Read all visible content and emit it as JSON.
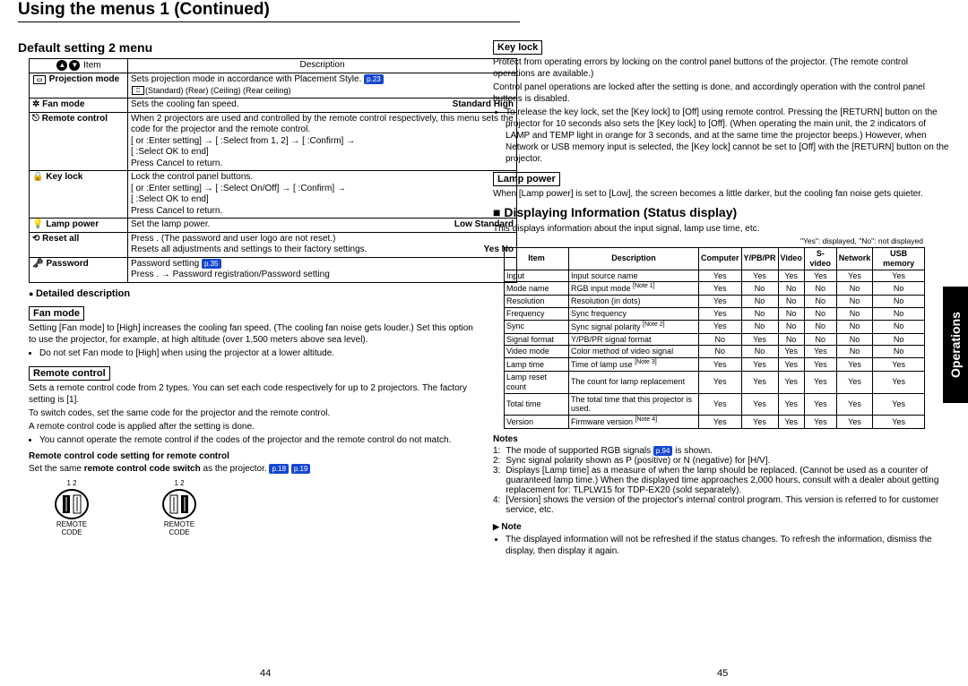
{
  "page_title": "Using the menus 1 (Continued)",
  "left": {
    "menu_title": "Default setting 2 menu",
    "table_header_item": "Item",
    "table_header_desc": "Description",
    "rows": {
      "proj_item": "Projection mode",
      "proj_desc_l1": "Sets projection mode in accordance with Placement Style.",
      "proj_desc_l2": "(Standard)          (Rear)          (Ceiling)          (Rear ceiling)",
      "fan_item": "Fan mode",
      "fan_desc": "Sets the cooling fan speed.",
      "fan_opts": "Standard      High",
      "rc_item": "Remote control",
      "rc_desc_l1": "When 2 projectors are used and controlled by the remote control respectively, this menu sets the code for the projector and the remote control.",
      "rc_desc_l2": "[   or   :Enter setting] → [     :Select from 1, 2] → [   :Confirm] →",
      "rc_desc_l3": "[     :Select OK to end]",
      "rc_desc_l4": "Press Cancel to return.",
      "key_item": "Key lock",
      "key_desc_l1": "Lock the control panel buttons.",
      "key_desc_l2": "[   or   :Enter setting] → [     :Select On/Off] → [   :Confirm] →",
      "key_desc_l3": "[     :Select OK to end]",
      "key_desc_l4": "Press Cancel to return.",
      "lamp_item": "Lamp power",
      "lamp_desc": "Set the lamp power.",
      "lamp_opts": "Low      Standard",
      "reset_item": "Reset all",
      "reset_desc_l1": "Press    . (The password and user logo are not reset.)",
      "reset_desc_l2": "Resets all adjustments and settings to their factory settings.",
      "reset_opts": "Yes      No",
      "pw_item": "Password",
      "pw_desc_l1": "Password setting",
      "pw_desc_l2": "Press    . → Password registration/Password setting"
    },
    "detailed": "Detailed description",
    "fan_head": "Fan mode",
    "fan_p1": "Setting [Fan mode] to [High] increases the cooling fan speed. (The cooling fan noise gets louder.) Set this option to use the projector, for example, at high altitude (over 1,500 meters above sea level).",
    "fan_b1": "Do not set Fan mode to [High] when using the projector at a lower altitude.",
    "rc_head": "Remote control",
    "rc_p1": "Sets a remote control code from 2 types. You can set each code respectively for up to 2 projectors. The factory setting is [1].",
    "rc_p2": "To switch codes, set the same code for the projector and the remote control.",
    "rc_p3": "A remote control code is applied after the setting is done.",
    "rc_b1": "You cannot operate the remote control if the codes of the projector and the remote control do not match.",
    "rcset_head": "Remote control code setting for remote control",
    "rcset_p1_a": "Set the same ",
    "rcset_p1_b": "remote control code switch",
    "rcset_p1_c": " as the projector.",
    "switch_labels": "1   2",
    "switch_caption": "REMOTE\nCODE"
  },
  "right": {
    "key_head": "Key lock",
    "key_p1": "Protect from operating errors by locking on the control panel buttons of the projector. (The remote control operations are available.)",
    "key_p2": "Control panel operations are locked after the setting is done, and accordingly operation with the control panel buttons is disabled.",
    "key_b1": "To release the key lock, set the [Key lock] to [Off] using remote control. Pressing the [RETURN] button on the projector for 10 seconds also sets the [Key lock] to [Off]. (When operating the main unit, the 2 indicators of LAMP and TEMP light in orange for 3 seconds, and at the same time the projector beeps.) However, when Network or USB memory input is selected, the [Key lock] cannot be set to [Off] with the [RETURN] button on the projector.",
    "lamp_head": "Lamp power",
    "lamp_p1": "When [Lamp power] is set to [Low], the screen becomes a little darker, but the cooling fan noise gets quieter.",
    "status_title": "Displaying Information (Status display)",
    "status_intro": "This displays information about the input signal, lamp use time, etc.",
    "status_legend": "\"Yes\": displayed, \"No\": not displayed",
    "status_cols": [
      "Item",
      "Description",
      "Computer",
      "Y/PB/PR",
      "Video",
      "S-video",
      "Network",
      "USB memory"
    ],
    "status_rows": [
      {
        "item": "Input",
        "desc": "Input source name",
        "v": [
          "Yes",
          "Yes",
          "Yes",
          "Yes",
          "Yes",
          "Yes"
        ]
      },
      {
        "item": "Mode name",
        "desc": "RGB input mode [Note 1]",
        "v": [
          "Yes",
          "No",
          "No",
          "No",
          "No",
          "No"
        ]
      },
      {
        "item": "Resolution",
        "desc": "Resolution (in dots)",
        "v": [
          "Yes",
          "No",
          "No",
          "No",
          "No",
          "No"
        ]
      },
      {
        "item": "Frequency",
        "desc": "Sync frequency",
        "v": [
          "Yes",
          "No",
          "No",
          "No",
          "No",
          "No"
        ]
      },
      {
        "item": "Sync",
        "desc": "Sync signal polarity [Note 2]",
        "v": [
          "Yes",
          "No",
          "No",
          "No",
          "No",
          "No"
        ]
      },
      {
        "item": "Signal format",
        "desc": "Y/PB/PR signal format",
        "v": [
          "No",
          "Yes",
          "No",
          "No",
          "No",
          "No"
        ]
      },
      {
        "item": "Video mode",
        "desc": "Color method of video signal",
        "v": [
          "No",
          "No",
          "Yes",
          "Yes",
          "No",
          "No"
        ]
      },
      {
        "item": "Lamp time",
        "desc": "Time of lamp use [Note 3]",
        "v": [
          "Yes",
          "Yes",
          "Yes",
          "Yes",
          "Yes",
          "Yes"
        ]
      },
      {
        "item": "Lamp reset count",
        "desc": "The count for lamp replacement",
        "v": [
          "Yes",
          "Yes",
          "Yes",
          "Yes",
          "Yes",
          "Yes"
        ]
      },
      {
        "item": "Total time",
        "desc": "The total time that this projector is used.",
        "v": [
          "Yes",
          "Yes",
          "Yes",
          "Yes",
          "Yes",
          "Yes"
        ]
      },
      {
        "item": "Version",
        "desc": "Firmware version [Note 4]",
        "v": [
          "Yes",
          "Yes",
          "Yes",
          "Yes",
          "Yes",
          "Yes"
        ]
      }
    ],
    "notes_head": "Notes",
    "note1": "The mode of supported RGB signals p.94 is shown.",
    "note2": "Sync signal polarity shown as P (positive) or N (negative) for [H/V].",
    "note3": "Displays [Lamp time] as a measure of when the lamp should be replaced. (Cannot be used as a counter of guaranteed lamp time.) When the displayed time approaches 2,000 hours, consult with a dealer about getting replacement for: TLPLW15 for TDP-EX20 (sold separately).",
    "note4": "[Version] shows the version of the projector's internal control program. This version is referred to for customer service, etc.",
    "notebox_head": "Note",
    "notebox_b1": "The displayed information will not be refreshed if the status changes. To refresh the information, dismiss the display, then display it again."
  },
  "sidetab": "Operations",
  "page_left": "44",
  "page_right": "45",
  "pills": {
    "p23": "p.23",
    "p35": "p.35",
    "p18": "p.18",
    "p19": "p.19",
    "p94": "p.94"
  }
}
